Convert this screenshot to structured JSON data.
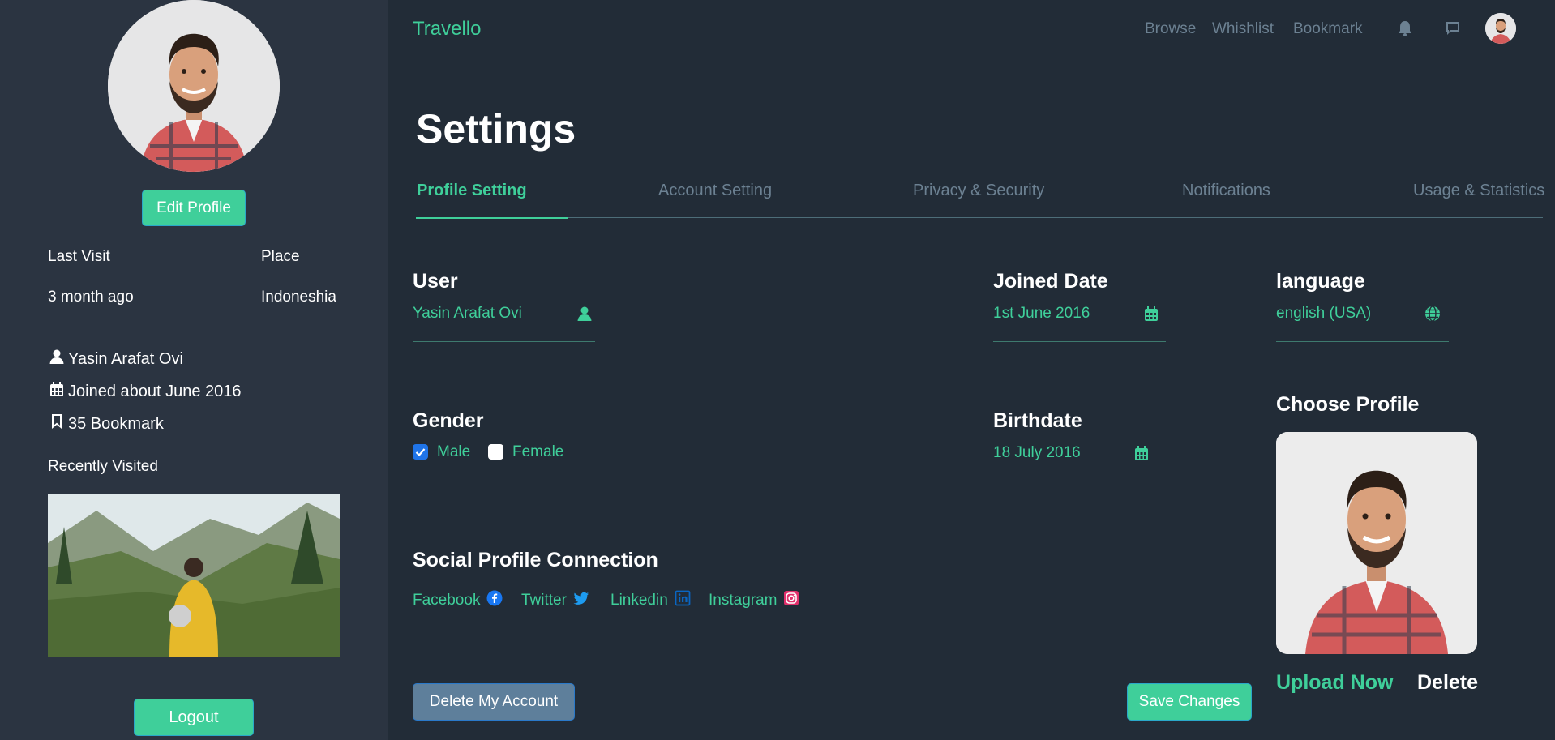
{
  "sidebar": {
    "edit_profile_label": "Edit Profile",
    "last_visit_label": "Last Visit",
    "place_label": "Place",
    "last_visit_value": "3 month ago",
    "place_value": "Indoneshia",
    "user_name": "Yasin Arafat Ovi",
    "joined": "Joined about June 2016",
    "bookmarks": "35 Bookmark",
    "recently_visited_label": "Recently Visited",
    "logout_label": "Logout"
  },
  "nav": {
    "brand": "Travello",
    "links": [
      "Browse",
      "Whishlist",
      "Bookmark"
    ]
  },
  "page": {
    "title": "Settings",
    "tabs": [
      "Profile Setting",
      "Account Setting",
      "Privacy & Security",
      "Notifications",
      "Usage & Statistics"
    ],
    "active_tab": "Profile Setting"
  },
  "form": {
    "user_label": "User",
    "user_value": "Yasin Arafat Ovi",
    "joined_label": "Joined Date",
    "joined_value": "1st June 2016",
    "language_label": "language",
    "language_value": "english (USA)",
    "gender_label": "Gender",
    "gender_male": "Male",
    "gender_female": "Female",
    "gender_male_checked": true,
    "gender_female_checked": false,
    "birthdate_label": "Birthdate",
    "birthdate_value": "18 July 2016",
    "choose_profile_label": "Choose Profile",
    "social_label": "Social Profile Connection",
    "social": [
      "Facebook",
      "Twitter",
      "Linkedin",
      "Instagram"
    ],
    "upload_label": "Upload Now",
    "delete_label": "Delete",
    "delete_account_label": "Delete My Account",
    "save_label": "Save Changes"
  },
  "colors": {
    "accent": "#3fcf9a",
    "background": "#222c37",
    "sidebar": "#2b3441",
    "muted": "#6c8192"
  }
}
